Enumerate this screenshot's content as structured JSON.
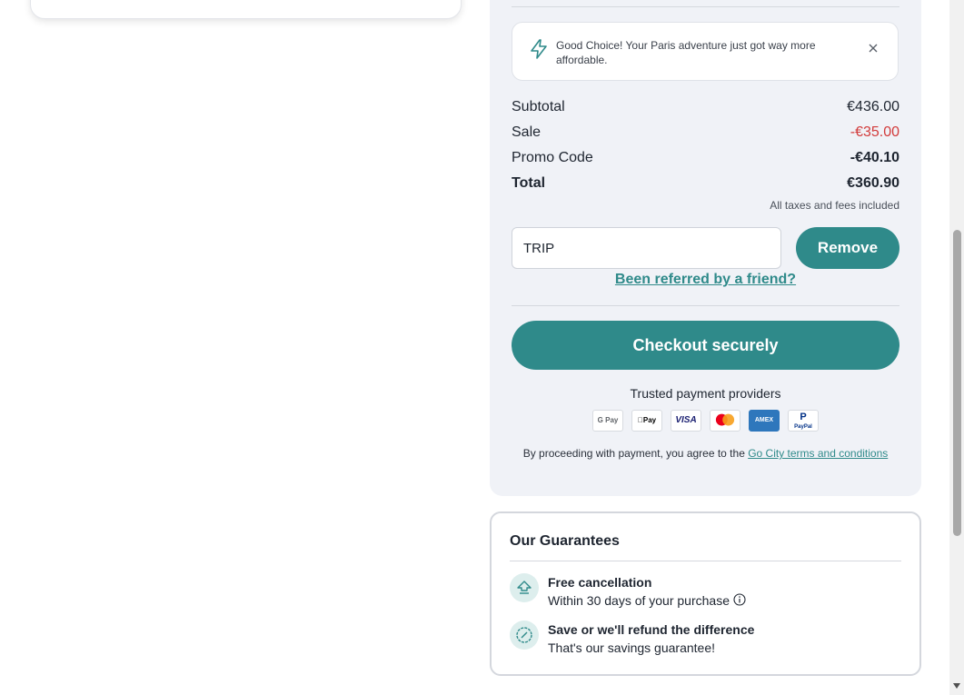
{
  "notice": {
    "message": "Good Choice! Your Paris adventure just got way more affordable.",
    "icon": "lightning-icon",
    "close_icon": "close-icon"
  },
  "summary": {
    "subtotal_label": "Subtotal",
    "subtotal_value": "€436.00",
    "sale_label": "Sale",
    "sale_value": "-€35.00",
    "promo_label": "Promo Code",
    "promo_value": "-€40.10",
    "total_label": "Total",
    "total_value": "€360.90",
    "taxes_note": "All taxes and fees included"
  },
  "promo": {
    "input_value": "TRIP",
    "remove_label": "Remove",
    "referred_link": "Been referred by a friend?"
  },
  "checkout": {
    "button_label": "Checkout securely",
    "trusted_label": "Trusted payment providers",
    "providers": [
      "G Pay",
      "Pay",
      "VISA",
      "Mastercard",
      "AMEX",
      "PayPal"
    ],
    "legal_prefix": "By proceeding with payment, you agree to the ",
    "legal_link": "Go City terms and conditions"
  },
  "guarantees": {
    "title": "Our Guarantees",
    "items": [
      {
        "title": "Free cancellation",
        "subtitle": "Within 30 days of your purchase"
      },
      {
        "title": "Save or we'll refund the difference",
        "subtitle": "That's our savings guarantee!"
      }
    ]
  },
  "colors": {
    "accent": "#2f8a8a",
    "sale_red": "#d23b3b",
    "panel_bg": "#f0f2f7"
  }
}
